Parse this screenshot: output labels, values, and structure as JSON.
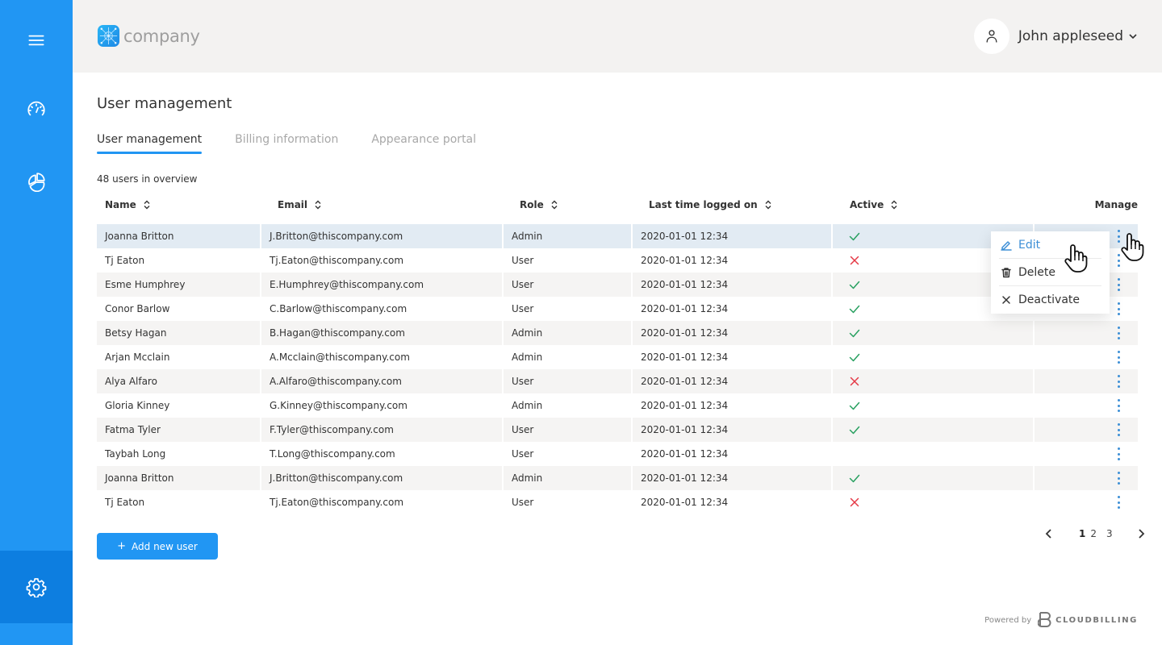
{
  "colors": {
    "brand": "#2196f3",
    "sidebar_active": "#0d7ee0",
    "header_bg": "#f3f2f1",
    "row_highlight": "#e2ebf3",
    "row_stripe": "#f5f4f3",
    "active_ok": "#28a060",
    "active_no": "#e53946",
    "link_blue": "#3d8fd6"
  },
  "sidebar": {
    "items": [
      {
        "name": "menu",
        "icon": "hamburger-icon"
      },
      {
        "name": "dashboard",
        "icon": "speedometer-icon"
      },
      {
        "name": "reports",
        "icon": "pie-chart-icon"
      },
      {
        "name": "settings",
        "icon": "gear-icon",
        "active": true
      }
    ]
  },
  "header": {
    "logo_text": "company",
    "user_name": "John appleseed"
  },
  "page": {
    "title": "User management",
    "tabs": [
      {
        "label": "User management",
        "active": true
      },
      {
        "label": "Billing information",
        "active": false
      },
      {
        "label": "Appearance portal",
        "active": false
      }
    ],
    "count_text": "48 users in overview"
  },
  "table": {
    "columns": {
      "name": "Name",
      "email": "Email",
      "role": "Role",
      "last_login": "Last time logged on",
      "active": "Active",
      "manage": "Manage"
    },
    "rows": [
      {
        "name": "Joanna Britton",
        "email": "J.Britton@thiscompany.com",
        "role": "Admin",
        "last_login": "2020-01-01 12:34",
        "active": "yes"
      },
      {
        "name": "Tj Eaton",
        "email": "Tj.Eaton@thiscompany.com",
        "role": "User",
        "last_login": "2020-01-01 12:34",
        "active": "no"
      },
      {
        "name": "Esme Humphrey",
        "email": "E.Humphrey@thiscompany.com",
        "role": "User",
        "last_login": "2020-01-01 12:34",
        "active": "yes"
      },
      {
        "name": "Conor Barlow",
        "email": "C.Barlow@thiscompany.com",
        "role": "User",
        "last_login": "2020-01-01 12:34",
        "active": "yes"
      },
      {
        "name": "Betsy Hagan",
        "email": "B.Hagan@thiscompany.com",
        "role": "Admin",
        "last_login": "2020-01-01 12:34",
        "active": "yes"
      },
      {
        "name": "Arjan Mcclain",
        "email": "A.Mcclain@thiscompany.com",
        "role": "Admin",
        "last_login": "2020-01-01 12:34",
        "active": "yes"
      },
      {
        "name": "Alya Alfaro",
        "email": "A.Alfaro@thiscompany.com",
        "role": "User",
        "last_login": "2020-01-01 12:34",
        "active": "no"
      },
      {
        "name": "Gloria Kinney",
        "email": "G.Kinney@thiscompany.com",
        "role": "Admin",
        "last_login": "2020-01-01 12:34",
        "active": "yes"
      },
      {
        "name": "Fatma Tyler",
        "email": "F.Tyler@thiscompany.com",
        "role": "User",
        "last_login": "2020-01-01 12:34",
        "active": "yes"
      },
      {
        "name": "Taybah Long",
        "email": "T.Long@thiscompany.com",
        "role": "User",
        "last_login": "2020-01-01 12:34",
        "active": "none"
      },
      {
        "name": "Joanna Britton",
        "email": "J.Britton@thiscompany.com",
        "role": "Admin",
        "last_login": "2020-01-01 12:34",
        "active": "yes"
      },
      {
        "name": "Tj Eaton",
        "email": "Tj.Eaton@thiscompany.com",
        "role": "User",
        "last_login": "2020-01-01 12:34",
        "active": "no"
      }
    ],
    "highlighted_row": 0
  },
  "manage_menu": {
    "items": [
      {
        "label": "Edit",
        "icon": "pencil-icon",
        "active": true
      },
      {
        "label": "Delete",
        "icon": "trash-icon",
        "active": false
      },
      {
        "label": "Deactivate",
        "icon": "close-icon",
        "active": false
      }
    ]
  },
  "actions": {
    "add_user_plus": "+",
    "add_user_label": "Add new user"
  },
  "pagination": {
    "current": 1,
    "pages": [
      "1",
      "2",
      "3"
    ]
  },
  "footer": {
    "powered_by": "Powered by",
    "brand": "CLOUDBILLING"
  }
}
